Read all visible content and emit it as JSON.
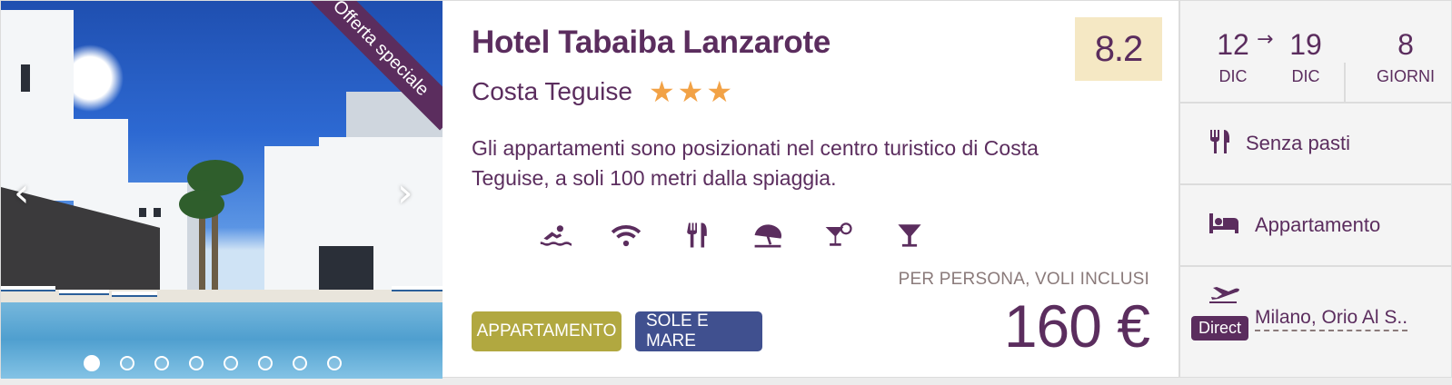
{
  "photo": {
    "ribbon": "Offerta speciale",
    "prev_icon": "chevron-left-icon",
    "next_icon": "chevron-right-icon",
    "slide_count": 8,
    "active_slide": 1,
    "prev_glyph": "‹",
    "next_glyph": "›"
  },
  "hotel": {
    "name": "Hotel Tabaiba Lanzarote",
    "location": "Costa Teguise",
    "stars": 3,
    "score": "8.2",
    "description": "Gli appartamenti sono posizionati nel centro turistico di Costa Teguise, a soli 100 metri dalla spiaggia.",
    "amenities": [
      "swimming-icon",
      "wifi-icon",
      "restaurant-icon",
      "beach-umbrella-icon",
      "cocktail-icon",
      "martini-icon"
    ]
  },
  "price": {
    "label": "PER PERSONA, VOLI INCLUSI",
    "amount": "160 €"
  },
  "tags": {
    "accommodation": "APPARTAMENTO",
    "theme": "SOLE E MARE"
  },
  "trip": {
    "from_day": "12",
    "from_month": "DIC",
    "arrow": "→",
    "to_day": "19",
    "to_month": "DIC",
    "duration": "8",
    "duration_unit": "GIORNI",
    "meal": "Senza pasti",
    "room": "Appartamento",
    "flight_badge": "Direct",
    "departure": "Milano, Orio Al S.."
  },
  "colors": {
    "brand_purple": "#5b2d5e",
    "star": "#f2a246",
    "score_bg": "#f5e8c4",
    "tag_accommodation": "#b1a840",
    "tag_theme": "#40508f"
  }
}
